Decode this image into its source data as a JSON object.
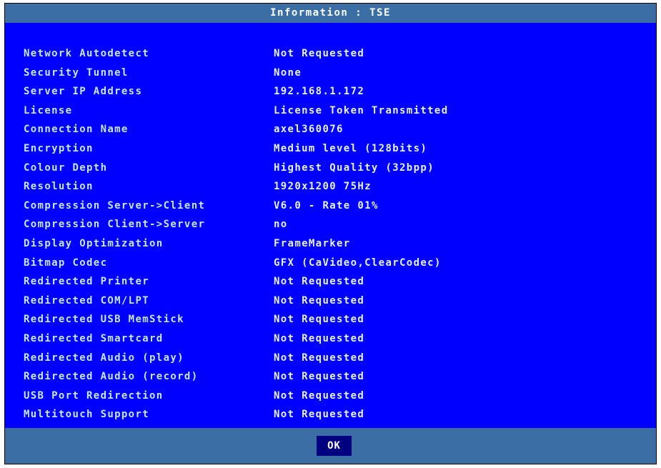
{
  "window": {
    "title": "Information : TSE"
  },
  "rows": [
    {
      "label": "Network Autodetect",
      "value": "Not Requested"
    },
    {
      "label": "Security Tunnel",
      "value": "None"
    },
    {
      "label": "Server IP Address",
      "value": "192.168.1.172"
    },
    {
      "label": "License",
      "value": "License Token Transmitted"
    },
    {
      "label": "Connection Name",
      "value": "axel360076"
    },
    {
      "label": "Encryption",
      "value": "Medium level (128bits)"
    },
    {
      "label": "Colour Depth",
      "value": "Highest Quality (32bpp)"
    },
    {
      "label": "Resolution",
      "value": "1920x1200 75Hz"
    },
    {
      "label": "Compression Server->Client",
      "value": "V6.0 - Rate 01%"
    },
    {
      "label": "Compression Client->Server",
      "value": "no"
    },
    {
      "label": "Display Optimization",
      "value": "FrameMarker"
    },
    {
      "label": "Bitmap Codec",
      "value": "GFX (CaVideo,ClearCodec)"
    },
    {
      "label": "Redirected Printer",
      "value": "Not Requested"
    },
    {
      "label": "Redirected COM/LPT",
      "value": "Not Requested"
    },
    {
      "label": "Redirected USB MemStick",
      "value": "Not Requested"
    },
    {
      "label": "Redirected Smartcard",
      "value": "Not Requested"
    },
    {
      "label": "Redirected Audio (play)",
      "value": "Not Requested"
    },
    {
      "label": "Redirected Audio (record)",
      "value": "Not Requested"
    },
    {
      "label": "USB Port Redirection",
      "value": "Not Requested"
    },
    {
      "label": "Multitouch Support",
      "value": "Not Requested"
    }
  ],
  "footer": {
    "ok_label": "OK"
  },
  "colors": {
    "background": "#0000ff",
    "titlebar": "#3a6ea5",
    "button": "#000080",
    "text": "#ffffff"
  }
}
